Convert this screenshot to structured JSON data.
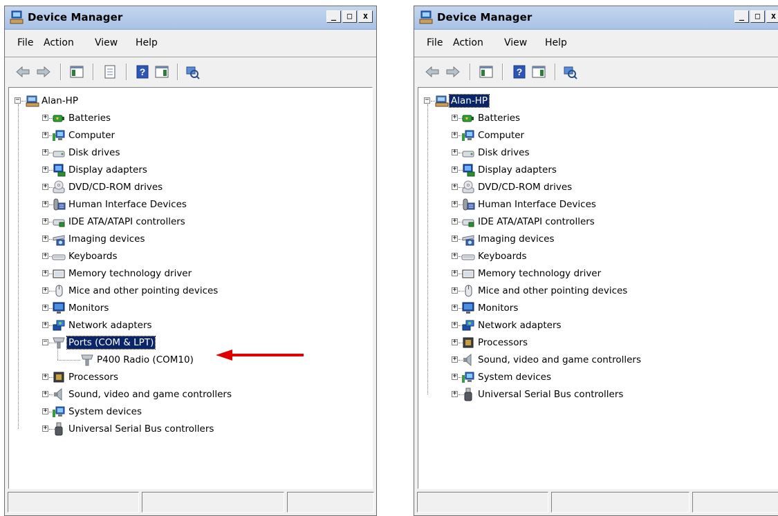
{
  "left_window": {
    "title": "Device Manager",
    "menu": [
      "File",
      "Action",
      "View",
      "Help"
    ],
    "root": "Alan-HP",
    "categories": [
      {
        "label": "Batteries",
        "icon": "battery-icon"
      },
      {
        "label": "Computer",
        "icon": "computer-icon"
      },
      {
        "label": "Disk drives",
        "icon": "disk-drive-icon"
      },
      {
        "label": "Display adapters",
        "icon": "display-adapter-icon"
      },
      {
        "label": "DVD/CD-ROM drives",
        "icon": "dvd-drive-icon"
      },
      {
        "label": "Human Interface Devices",
        "icon": "hid-icon"
      },
      {
        "label": "IDE ATA/ATAPI controllers",
        "icon": "ide-controller-icon"
      },
      {
        "label": "Imaging devices",
        "icon": "imaging-device-icon"
      },
      {
        "label": "Keyboards",
        "icon": "keyboard-icon"
      },
      {
        "label": "Memory technology driver",
        "icon": "memory-icon"
      },
      {
        "label": "Mice and other pointing devices",
        "icon": "mouse-icon"
      },
      {
        "label": "Monitors",
        "icon": "monitor-icon"
      },
      {
        "label": "Network adapters",
        "icon": "network-adapter-icon"
      },
      {
        "label": "Ports (COM & LPT)",
        "icon": "port-icon",
        "expanded": true,
        "selected": true
      },
      {
        "label": "P400 Radio (COM10)",
        "icon": "port-icon",
        "child": true
      },
      {
        "label": "Processors",
        "icon": "processor-icon"
      },
      {
        "label": "Sound, video and game controllers",
        "icon": "sound-icon"
      },
      {
        "label": "System devices",
        "icon": "system-devices-icon"
      },
      {
        "label": "Universal Serial Bus controllers",
        "icon": "usb-icon"
      }
    ]
  },
  "right_window": {
    "title": "Device Manager",
    "menu": [
      "File",
      "Action",
      "View",
      "Help"
    ],
    "root": "Alan-HP",
    "root_selected": true,
    "categories": [
      {
        "label": "Batteries",
        "icon": "battery-icon"
      },
      {
        "label": "Computer",
        "icon": "computer-icon"
      },
      {
        "label": "Disk drives",
        "icon": "disk-drive-icon"
      },
      {
        "label": "Display adapters",
        "icon": "display-adapter-icon"
      },
      {
        "label": "DVD/CD-ROM drives",
        "icon": "dvd-drive-icon"
      },
      {
        "label": "Human Interface Devices",
        "icon": "hid-icon"
      },
      {
        "label": "IDE ATA/ATAPI controllers",
        "icon": "ide-controller-icon"
      },
      {
        "label": "Imaging devices",
        "icon": "imaging-device-icon"
      },
      {
        "label": "Keyboards",
        "icon": "keyboard-icon"
      },
      {
        "label": "Memory technology driver",
        "icon": "memory-icon"
      },
      {
        "label": "Mice and other pointing devices",
        "icon": "mouse-icon"
      },
      {
        "label": "Monitors",
        "icon": "monitor-icon"
      },
      {
        "label": "Network adapters",
        "icon": "network-adapter-icon"
      },
      {
        "label": "Processors",
        "icon": "processor-icon"
      },
      {
        "label": "Sound, video and game controllers",
        "icon": "sound-icon"
      },
      {
        "label": "System devices",
        "icon": "system-devices-icon"
      },
      {
        "label": "Universal Serial Bus controllers",
        "icon": "usb-icon"
      }
    ]
  },
  "annotation": {
    "color": "#e00000",
    "points_to": "P400 Radio (COM10)"
  },
  "colors": {
    "selection": "#0a246a",
    "title_bar": "#b7cdea",
    "chrome": "#f0f0f0"
  }
}
